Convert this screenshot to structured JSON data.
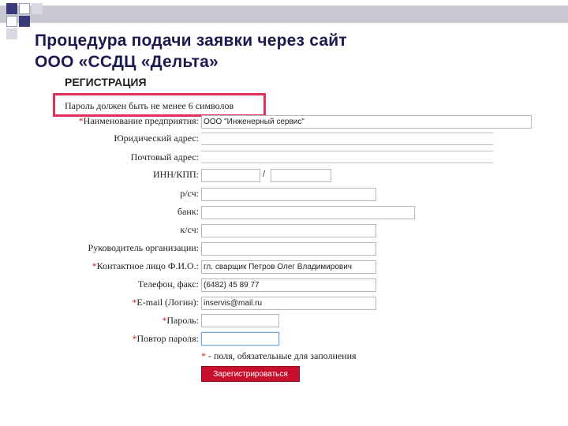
{
  "slide": {
    "title_line1": "Процедура подачи заявки через сайт",
    "title_line2": "ООО «ССДЦ «Дельта»"
  },
  "form": {
    "heading": "РЕГИСТРАЦИЯ",
    "password_note": "Пароль должен быть не менее 6 символов",
    "required_marker": "*",
    "fields": {
      "company_name": {
        "label": "Наименование предприятия:",
        "value": "ООО \"Инженерный сервис\""
      },
      "legal_address": {
        "label": "Юридический адрес:",
        "value": ""
      },
      "postal_address": {
        "label": "Почтовый адрес:",
        "value": ""
      },
      "inn_kpp": {
        "label": "ИНН/КПП:",
        "inn_value": "",
        "kpp_value": "",
        "separator": "/"
      },
      "account": {
        "label": "р/сч:",
        "value": ""
      },
      "bank": {
        "label": "банк:",
        "value": ""
      },
      "corr_account": {
        "label": "к/сч:",
        "value": ""
      },
      "director": {
        "label": "Руководитель организации:",
        "value": ""
      },
      "contact_person": {
        "label": "Контактное лицо Ф.И.О.:",
        "value": "гл. сварщик Петров Олег Владимирович"
      },
      "phone_fax": {
        "label": "Телефон, факс:",
        "value": "(6482) 45 89 77"
      },
      "email": {
        "label": "E-mail (Логин):",
        "value": "inservis@mail.ru"
      },
      "password": {
        "label": "Пароль:",
        "value": ""
      },
      "password_repeat": {
        "label": "Повтор пароля:",
        "value": ""
      }
    },
    "required_note": "- поля, обязательные для заполнения",
    "submit_label": "Зарегистрироваться"
  },
  "colors": {
    "title": "#1c1a4e",
    "highlight_border": "#e0305a",
    "required_star": "#cc2222",
    "submit_bg": "#c8102e",
    "deco_blue": "#3a3a7a"
  }
}
